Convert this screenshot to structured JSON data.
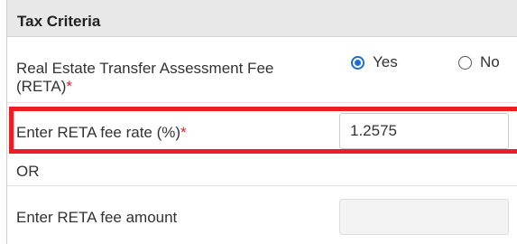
{
  "section": {
    "title": "Tax Criteria"
  },
  "reta": {
    "label": "Real Estate Transfer Assessment Fee",
    "label_line2": "(RETA)",
    "required_mark": "*",
    "options": [
      {
        "label": "Yes",
        "selected": true
      },
      {
        "label": "No",
        "selected": false
      }
    ]
  },
  "fee_rate": {
    "label": "Enter RETA fee rate (%)",
    "required_mark": "*",
    "value": "1.2575"
  },
  "separator": {
    "text": "OR"
  },
  "fee_amount": {
    "label": "Enter RETA fee amount",
    "value": ""
  },
  "colors": {
    "accent": "#1a6fd6",
    "highlight": "#ee1c24",
    "required": "#d9232a"
  }
}
